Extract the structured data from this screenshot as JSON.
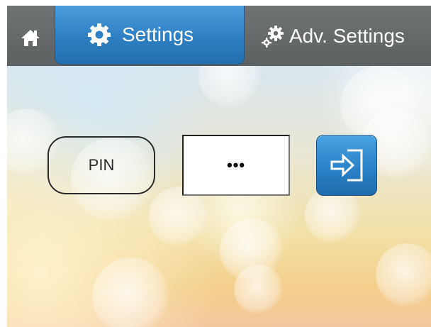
{
  "nav": {
    "home_icon": "home-icon",
    "tabs": [
      {
        "label": "Settings",
        "icon": "gear-icon",
        "active": true
      },
      {
        "label": "Adv. Settings",
        "icon": "gears-icon",
        "active": false
      }
    ]
  },
  "login": {
    "label": "PIN",
    "value": "•••",
    "button_icon": "sign-in-icon"
  },
  "colors": {
    "accent": "#2c7dc0",
    "topbar": "#666a6b"
  }
}
